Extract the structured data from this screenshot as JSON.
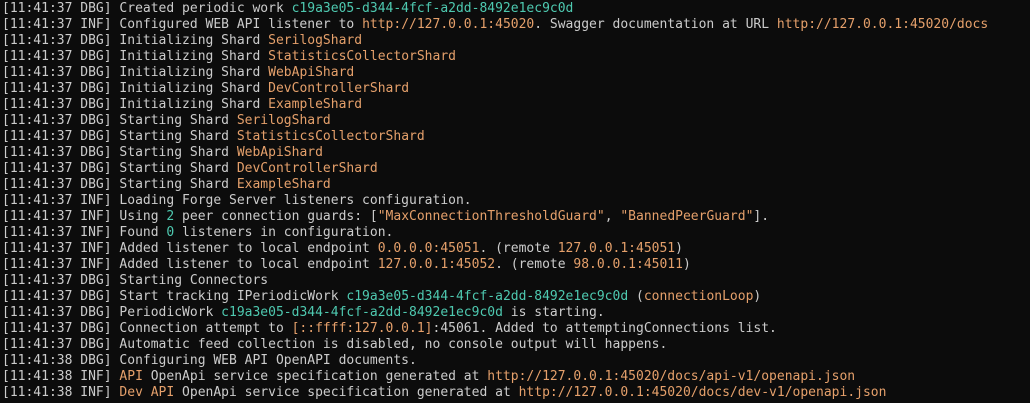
{
  "colors": {
    "background": "#0c0c0c",
    "default": "#cccccc",
    "guid": "#4ec9b0",
    "shard": "#e5a06b",
    "url": "#e5a06b",
    "string": "#e5a06b",
    "number": "#4ec9b0",
    "warm": "#e5a06b"
  },
  "lines": [
    {
      "time": "11:41:37",
      "level": "DBG",
      "parts": [
        {
          "t": "Created periodic work ",
          "k": "default"
        },
        {
          "t": "c19a3e05-d344-4fcf-a2dd-8492e1ec9c0d",
          "k": "guid"
        }
      ]
    },
    {
      "time": "11:41:37",
      "level": "INF",
      "parts": [
        {
          "t": "Configured WEB API listener to ",
          "k": "default"
        },
        {
          "t": "http://127.0.0.1:45020",
          "k": "url"
        },
        {
          "t": ". Swagger documentation at URL ",
          "k": "default"
        },
        {
          "t": "http://127.0.0.1:45020/docs",
          "k": "url"
        }
      ]
    },
    {
      "time": "11:41:37",
      "level": "DBG",
      "parts": [
        {
          "t": "Initializing Shard ",
          "k": "default"
        },
        {
          "t": "SerilogShard",
          "k": "shard"
        }
      ]
    },
    {
      "time": "11:41:37",
      "level": "DBG",
      "parts": [
        {
          "t": "Initializing Shard ",
          "k": "default"
        },
        {
          "t": "StatisticsCollectorShard",
          "k": "shard"
        }
      ]
    },
    {
      "time": "11:41:37",
      "level": "DBG",
      "parts": [
        {
          "t": "Initializing Shard ",
          "k": "default"
        },
        {
          "t": "WebApiShard",
          "k": "shard"
        }
      ]
    },
    {
      "time": "11:41:37",
      "level": "DBG",
      "parts": [
        {
          "t": "Initializing Shard ",
          "k": "default"
        },
        {
          "t": "DevControllerShard",
          "k": "shard"
        }
      ]
    },
    {
      "time": "11:41:37",
      "level": "DBG",
      "parts": [
        {
          "t": "Initializing Shard ",
          "k": "default"
        },
        {
          "t": "ExampleShard",
          "k": "shard"
        }
      ]
    },
    {
      "time": "11:41:37",
      "level": "DBG",
      "parts": [
        {
          "t": "Starting Shard ",
          "k": "default"
        },
        {
          "t": "SerilogShard",
          "k": "shard"
        }
      ]
    },
    {
      "time": "11:41:37",
      "level": "DBG",
      "parts": [
        {
          "t": "Starting Shard ",
          "k": "default"
        },
        {
          "t": "StatisticsCollectorShard",
          "k": "shard"
        }
      ]
    },
    {
      "time": "11:41:37",
      "level": "DBG",
      "parts": [
        {
          "t": "Starting Shard ",
          "k": "default"
        },
        {
          "t": "WebApiShard",
          "k": "shard"
        }
      ]
    },
    {
      "time": "11:41:37",
      "level": "DBG",
      "parts": [
        {
          "t": "Starting Shard ",
          "k": "default"
        },
        {
          "t": "DevControllerShard",
          "k": "shard"
        }
      ]
    },
    {
      "time": "11:41:37",
      "level": "DBG",
      "parts": [
        {
          "t": "Starting Shard ",
          "k": "default"
        },
        {
          "t": "ExampleShard",
          "k": "shard"
        }
      ]
    },
    {
      "time": "11:41:37",
      "level": "INF",
      "parts": [
        {
          "t": "Loading Forge Server listeners configuration.",
          "k": "default"
        }
      ]
    },
    {
      "time": "11:41:37",
      "level": "INF",
      "parts": [
        {
          "t": "Using ",
          "k": "default"
        },
        {
          "t": "2",
          "k": "number"
        },
        {
          "t": " peer connection guards: [",
          "k": "default"
        },
        {
          "t": "\"MaxConnectionThresholdGuard\"",
          "k": "string"
        },
        {
          "t": ", ",
          "k": "default"
        },
        {
          "t": "\"BannedPeerGuard\"",
          "k": "string"
        },
        {
          "t": "].",
          "k": "default"
        }
      ]
    },
    {
      "time": "11:41:37",
      "level": "INF",
      "parts": [
        {
          "t": "Found ",
          "k": "default"
        },
        {
          "t": "0",
          "k": "number"
        },
        {
          "t": " listeners in configuration.",
          "k": "default"
        }
      ]
    },
    {
      "time": "11:41:37",
      "level": "INF",
      "parts": [
        {
          "t": "Added listener to local endpoint ",
          "k": "default"
        },
        {
          "t": "0.0.0.0:45051",
          "k": "url"
        },
        {
          "t": ". (remote ",
          "k": "default"
        },
        {
          "t": "127.0.0.1:45051",
          "k": "url"
        },
        {
          "t": ")",
          "k": "default"
        }
      ]
    },
    {
      "time": "11:41:37",
      "level": "INF",
      "parts": [
        {
          "t": "Added listener to local endpoint ",
          "k": "default"
        },
        {
          "t": "127.0.0.1:45052",
          "k": "url"
        },
        {
          "t": ". (remote ",
          "k": "default"
        },
        {
          "t": "98.0.0.1:45011",
          "k": "url"
        },
        {
          "t": ")",
          "k": "default"
        }
      ]
    },
    {
      "time": "11:41:37",
      "level": "DBG",
      "parts": [
        {
          "t": "Starting Connectors",
          "k": "default"
        }
      ]
    },
    {
      "time": "11:41:37",
      "level": "DBG",
      "parts": [
        {
          "t": "Start tracking IPeriodicWork ",
          "k": "default"
        },
        {
          "t": "c19a3e05-d344-4fcf-a2dd-8492e1ec9c0d",
          "k": "guid"
        },
        {
          "t": " (",
          "k": "default"
        },
        {
          "t": "connectionLoop",
          "k": "warm"
        },
        {
          "t": ")",
          "k": "default"
        }
      ]
    },
    {
      "time": "11:41:37",
      "level": "DBG",
      "parts": [
        {
          "t": "PeriodicWork ",
          "k": "default"
        },
        {
          "t": "c19a3e05-d344-4fcf-a2dd-8492e1ec9c0d",
          "k": "guid"
        },
        {
          "t": " is starting.",
          "k": "default"
        }
      ]
    },
    {
      "time": "11:41:37",
      "level": "DBG",
      "parts": [
        {
          "t": "Connection attempt to ",
          "k": "default"
        },
        {
          "t": "[::ffff:127.0.0.1]",
          "k": "url"
        },
        {
          "t": ":45061. Added to attemptingConnections list.",
          "k": "default"
        }
      ]
    },
    {
      "time": "11:41:37",
      "level": "DBG",
      "parts": [
        {
          "t": "Automatic feed collection is disabled, no console output will happens.",
          "k": "default"
        }
      ]
    },
    {
      "time": "11:41:38",
      "level": "DBG",
      "parts": [
        {
          "t": "Configuring WEB API OpenAPI documents.",
          "k": "default"
        }
      ]
    },
    {
      "time": "11:41:38",
      "level": "INF",
      "parts": [
        {
          "t": "API",
          "k": "warm"
        },
        {
          "t": " OpenApi service specification generated at ",
          "k": "default"
        },
        {
          "t": "http://127.0.0.1:45020/docs/api-v1/openapi.json",
          "k": "url"
        }
      ]
    },
    {
      "time": "11:41:38",
      "level": "INF",
      "parts": [
        {
          "t": "Dev API",
          "k": "warm"
        },
        {
          "t": " OpenApi service specification generated at ",
          "k": "default"
        },
        {
          "t": "http://127.0.0.1:45020/docs/dev-v1/openapi.json",
          "k": "url"
        }
      ]
    }
  ]
}
